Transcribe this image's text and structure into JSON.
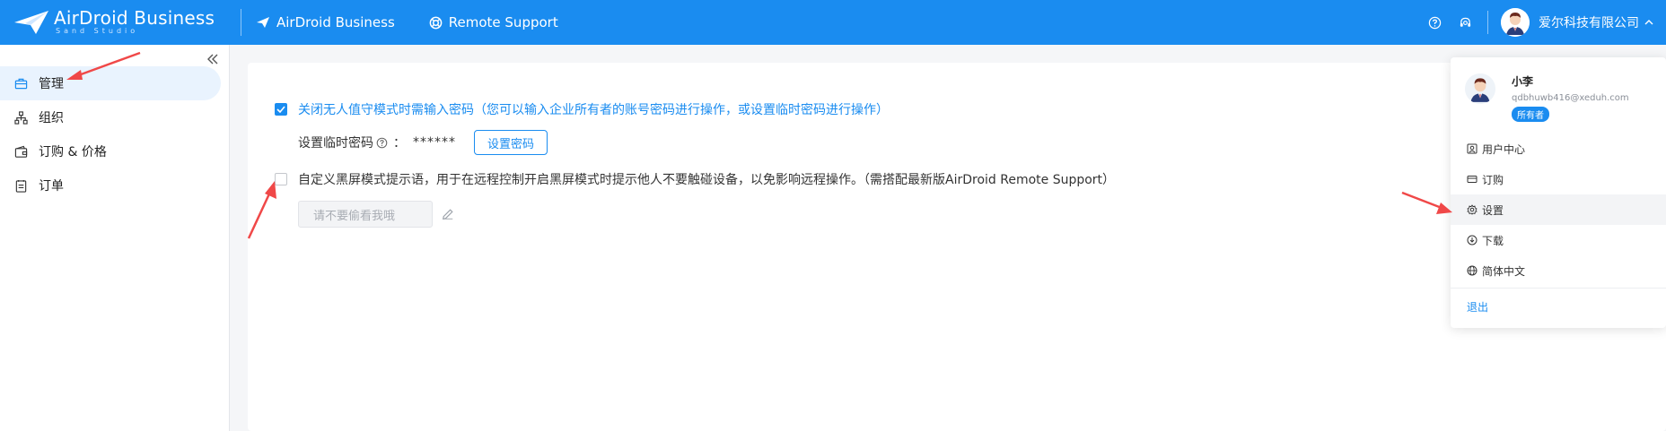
{
  "topbar": {
    "logo_title": "AirDroid Business",
    "logo_sub": "Sand Studio",
    "links": [
      {
        "label": "AirDroid Business",
        "icon": "paper-plane-icon"
      },
      {
        "label": "Remote Support",
        "icon": "lifebuoy-icon"
      }
    ],
    "company": "爱尔科技有限公司",
    "icons": [
      "help-circle-icon",
      "headset-icon",
      "avatar",
      "chevron-up-icon"
    ]
  },
  "sidebar": {
    "items": [
      {
        "label": "管理",
        "icon": "briefcase-icon",
        "active": true
      },
      {
        "label": "组织",
        "icon": "org-tree-icon",
        "active": false
      },
      {
        "label": "订购 & 价格",
        "icon": "wallet-icon",
        "active": false
      },
      {
        "label": "订单",
        "icon": "order-list-icon",
        "active": false
      }
    ]
  },
  "main": {
    "option1": {
      "checked": true,
      "text": "关闭无人值守模式时需输入密码（您可以输入企业所有者的账号密码进行操作，或设置临时密码进行操作）"
    },
    "temp_password": {
      "label": "设置临时密码",
      "colon": "：",
      "value": "******",
      "button": "设置密码"
    },
    "option2": {
      "checked": false,
      "text": "自定义黑屏模式提示语，用于在远程控制开启黑屏模式时提示他人不要触碰设备，以免影响远程操作。（需搭配最新版AirDroid Remote Support）"
    },
    "black_screen_input": {
      "placeholder": "请不要偷看我哦"
    }
  },
  "dropdown": {
    "name": "小李",
    "email": "qdbhuwb416@xeduh.com",
    "badge": "所有者",
    "items": [
      {
        "label": "用户中心",
        "icon": "user-card-icon"
      },
      {
        "label": "订购",
        "icon": "card-icon"
      },
      {
        "label": "设置",
        "icon": "gear-icon",
        "hover": true
      },
      {
        "label": "下载",
        "icon": "download-icon"
      },
      {
        "label": "简体中文",
        "icon": "globe-icon"
      }
    ],
    "logout": "退出"
  },
  "colors": {
    "brand": "#1a8cf0",
    "arrow": "#f04848"
  }
}
